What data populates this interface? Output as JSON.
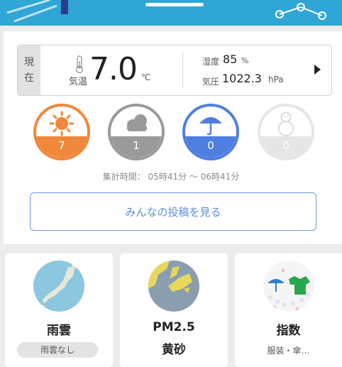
{
  "current": {
    "tag_line1": "現",
    "tag_line2": "在",
    "temp_label": "気温",
    "temp_value": "7.0",
    "temp_unit": "℃",
    "humidity_label": "湿度",
    "humidity_value": "85",
    "humidity_unit": "%",
    "pressure_label": "気圧",
    "pressure_value": "1022.3",
    "pressure_unit": "hPa"
  },
  "votes": [
    {
      "weather": "sunny",
      "icon": "sun-icon",
      "count": "7",
      "color": "#f0873a"
    },
    {
      "weather": "cloudy",
      "icon": "cloud-icon",
      "count": "1",
      "color": "#9a9a9a"
    },
    {
      "weather": "rainy",
      "icon": "umbrella-icon",
      "count": "0",
      "color": "#4e7ee0"
    },
    {
      "weather": "snowy",
      "icon": "snowman-icon",
      "count": "0",
      "color": "#e6e6e6"
    }
  ],
  "tally": "集計時間： 05時41分 〜 06時41分",
  "posts_button": "みんなの投稿を見る",
  "features": {
    "rain": {
      "title": "雨雲",
      "status": "雨雲なし",
      "icon": "japan-map-icon"
    },
    "pm": {
      "title": "PM2.5",
      "subtitle": "黄砂",
      "icon": "dust-map-icon"
    },
    "index": {
      "title": "指数",
      "subtitle": "服装・傘…",
      "icon": "umbrella-shirt-icon"
    }
  },
  "colors": {
    "accent_blue": "#5b8dd6",
    "banner": "#2fa6d6"
  }
}
